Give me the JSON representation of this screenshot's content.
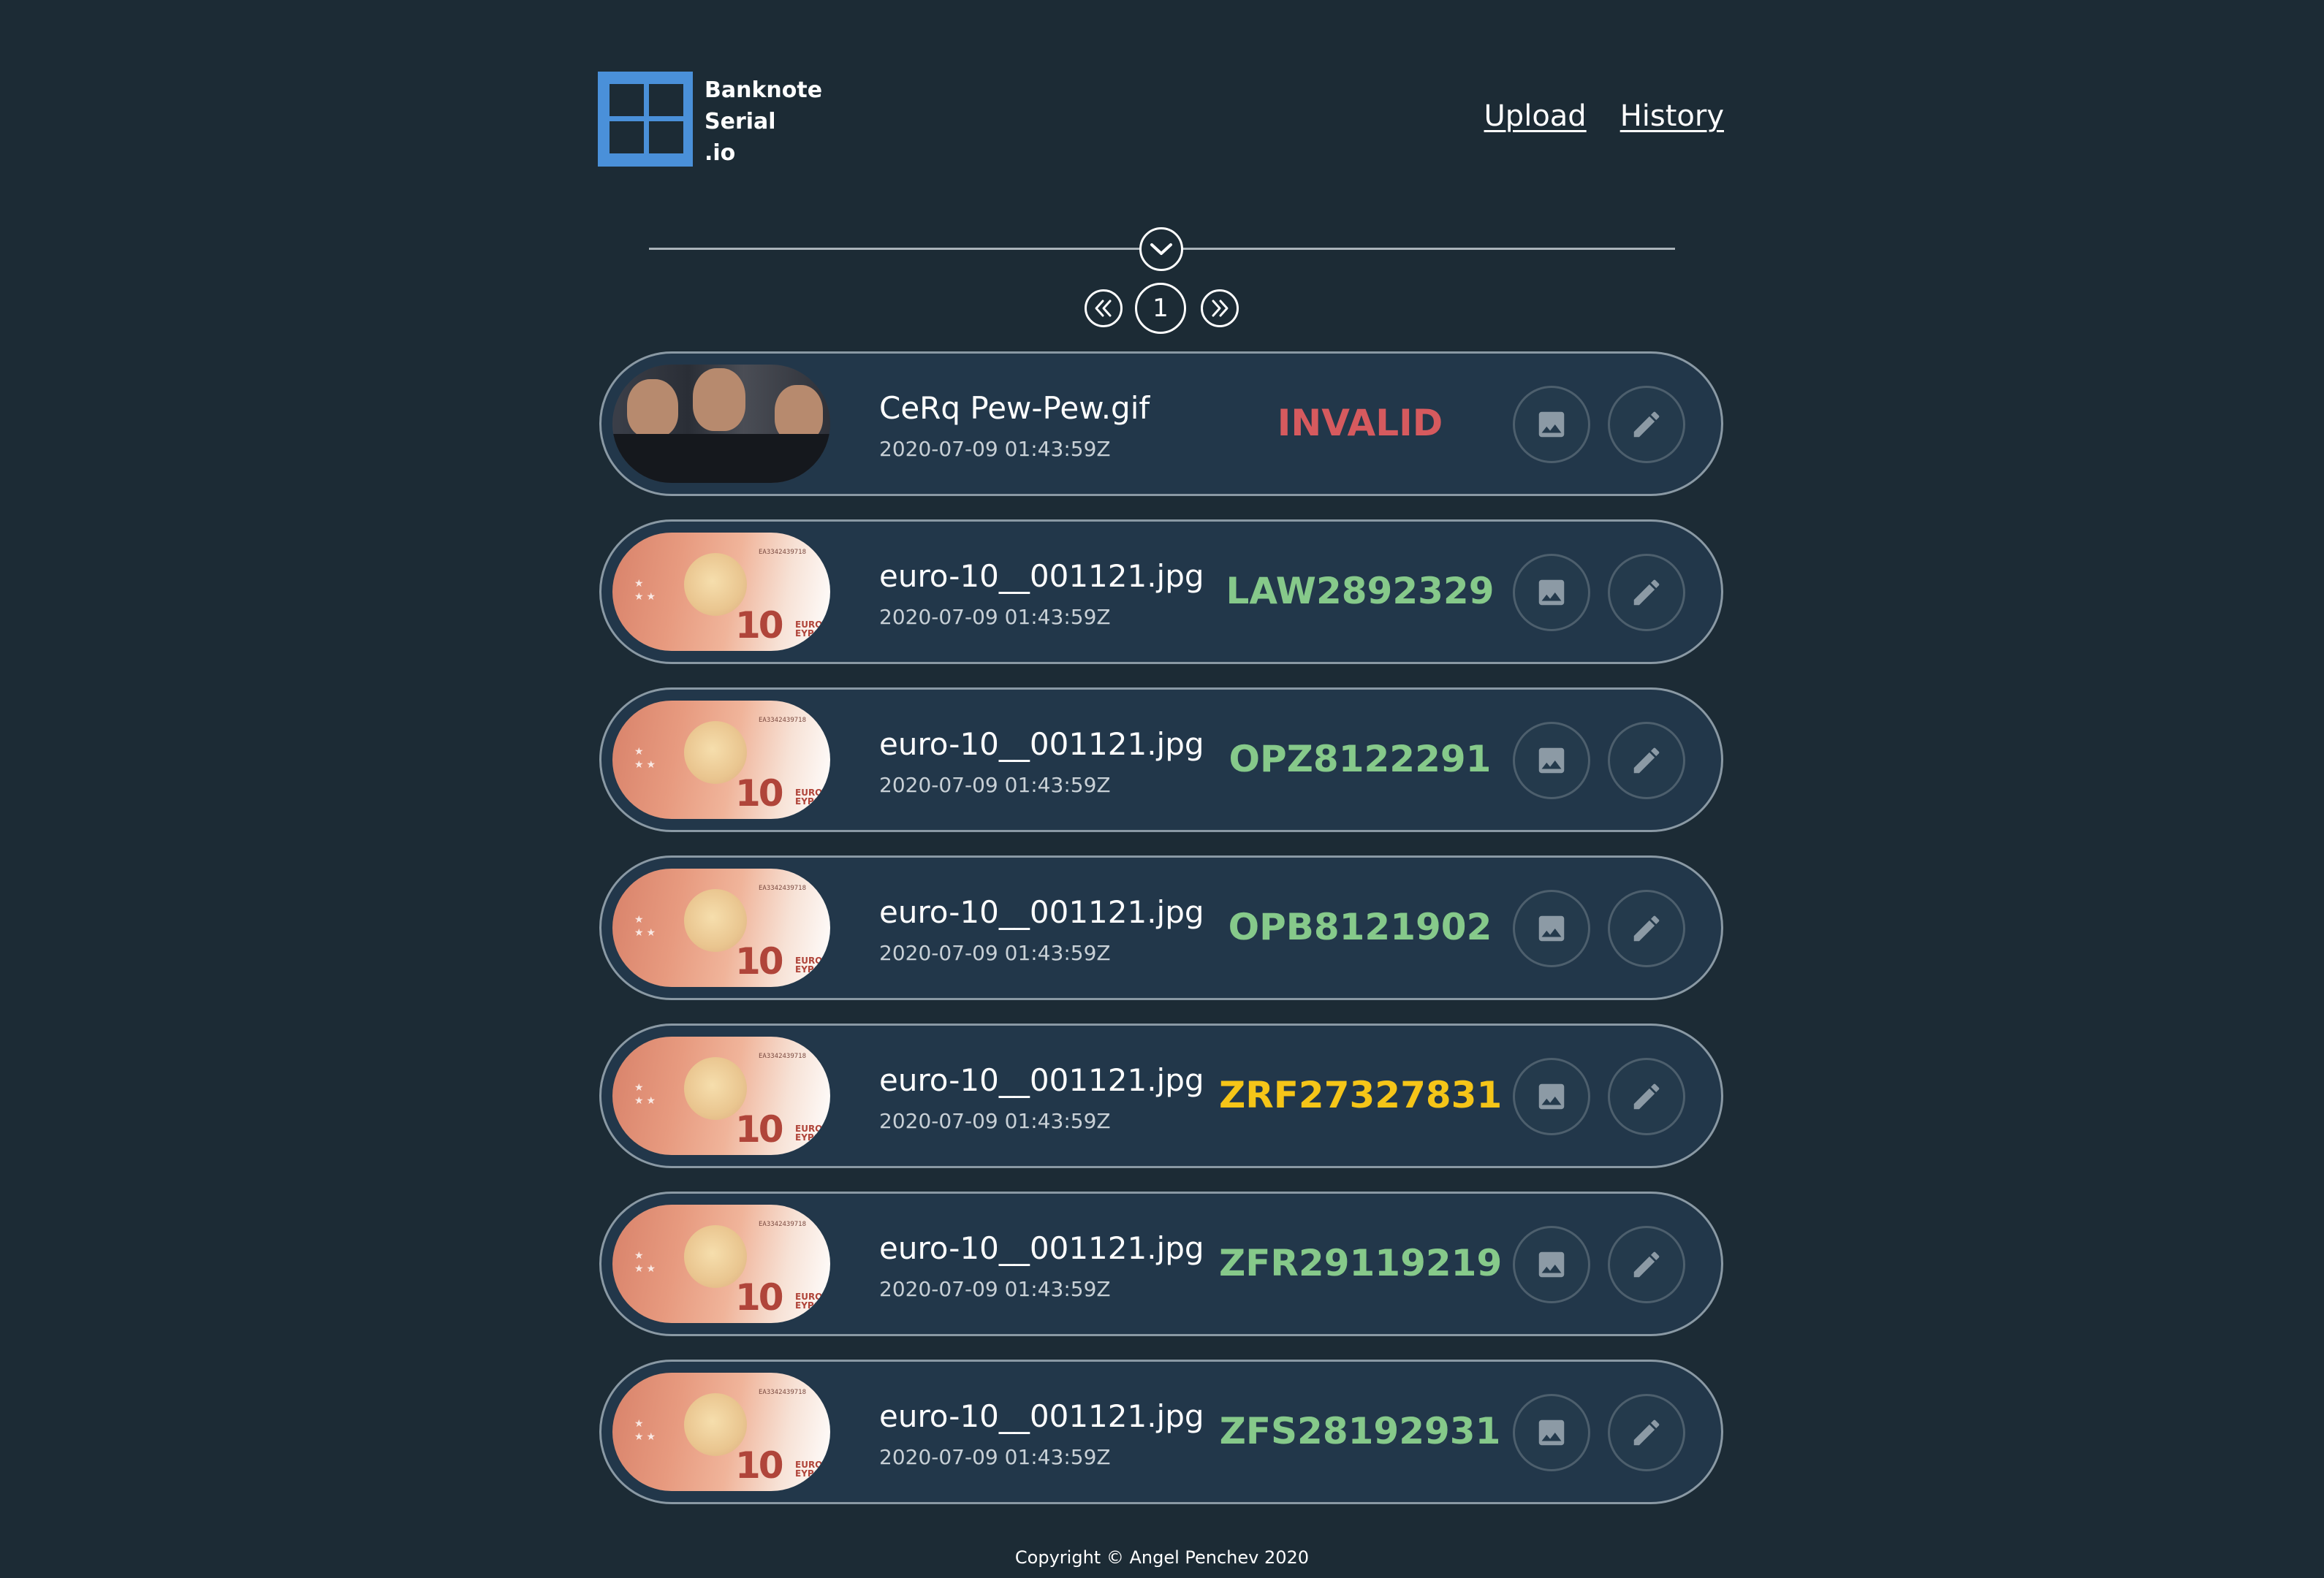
{
  "brand": {
    "line1": "Banknote",
    "line2": "Serial",
    "line3": ".io",
    "color": "#4a90d9"
  },
  "nav": {
    "upload": "Upload",
    "history": "History"
  },
  "pagination": {
    "current_page": "1"
  },
  "icons": {
    "collapse": "chevron-down-circle-icon",
    "prev": "double-chevron-left-icon",
    "next": "double-chevron-right-icon",
    "image": "image-icon",
    "edit": "pencil-icon"
  },
  "status_colors": {
    "invalid": "#d65a5e",
    "valid": "#86c98a",
    "warning": "#f5c518"
  },
  "items": [
    {
      "filename": "CeRq Pew-Pew.gif",
      "timestamp": "2020-07-09 01:43:59Z",
      "serial": "INVALID",
      "status": "invalid",
      "thumbnail": "gif-photo"
    },
    {
      "filename": "euro-10__001121.jpg",
      "timestamp": "2020-07-09 01:43:59Z",
      "serial": "LAW2892329",
      "status": "valid",
      "thumbnail": "euro-10-banknote"
    },
    {
      "filename": "euro-10__001121.jpg",
      "timestamp": "2020-07-09 01:43:59Z",
      "serial": "OPZ8122291",
      "status": "valid",
      "thumbnail": "euro-10-banknote"
    },
    {
      "filename": "euro-10__001121.jpg",
      "timestamp": "2020-07-09 01:43:59Z",
      "serial": "OPB8121902",
      "status": "valid",
      "thumbnail": "euro-10-banknote"
    },
    {
      "filename": "euro-10__001121.jpg",
      "timestamp": "2020-07-09 01:43:59Z",
      "serial": "ZRF27327831",
      "status": "warning",
      "thumbnail": "euro-10-banknote"
    },
    {
      "filename": "euro-10__001121.jpg",
      "timestamp": "2020-07-09 01:43:59Z",
      "serial": "ZFR29119219",
      "status": "valid",
      "thumbnail": "euro-10-banknote"
    },
    {
      "filename": "euro-10__001121.jpg",
      "timestamp": "2020-07-09 01:43:59Z",
      "serial": "ZFS28192931",
      "status": "valid",
      "thumbnail": "euro-10-banknote"
    }
  ],
  "banknote": {
    "denomination": "10",
    "currency_line1": "EURO",
    "currency_line2": "ΕΥΡΩ",
    "printed_serial": "EA3342439718"
  },
  "footer": {
    "copyright": "Copyright © Angel Penchev 2020"
  }
}
